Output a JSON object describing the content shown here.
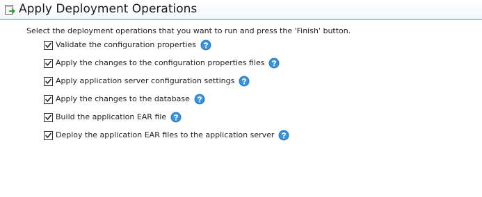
{
  "header": {
    "title": "Apply Deployment Operations",
    "icon": "apply-wizard-icon"
  },
  "instructions": "Select the deployment operations that you want to run and press the 'Finish' button.",
  "operations": [
    {
      "label": "Validate the configuration properties",
      "checked": true,
      "help_icon": "help-icon"
    },
    {
      "label": "Apply the changes to the configuration properties files",
      "checked": true,
      "help_icon": "help-icon"
    },
    {
      "label": "Apply application server configuration settings",
      "checked": true,
      "help_icon": "help-icon"
    },
    {
      "label": "Apply the changes to the database",
      "checked": true,
      "help_icon": "help-icon"
    },
    {
      "label": "Build the application EAR file",
      "checked": true,
      "help_icon": "help-icon"
    },
    {
      "label": "Deploy the application EAR files to the application server",
      "checked": true,
      "help_icon": "help-icon"
    }
  ],
  "colors": {
    "header_rule": "#a9c4e3",
    "help_icon": "#2a7fc6",
    "text": "#1e1e1e"
  }
}
